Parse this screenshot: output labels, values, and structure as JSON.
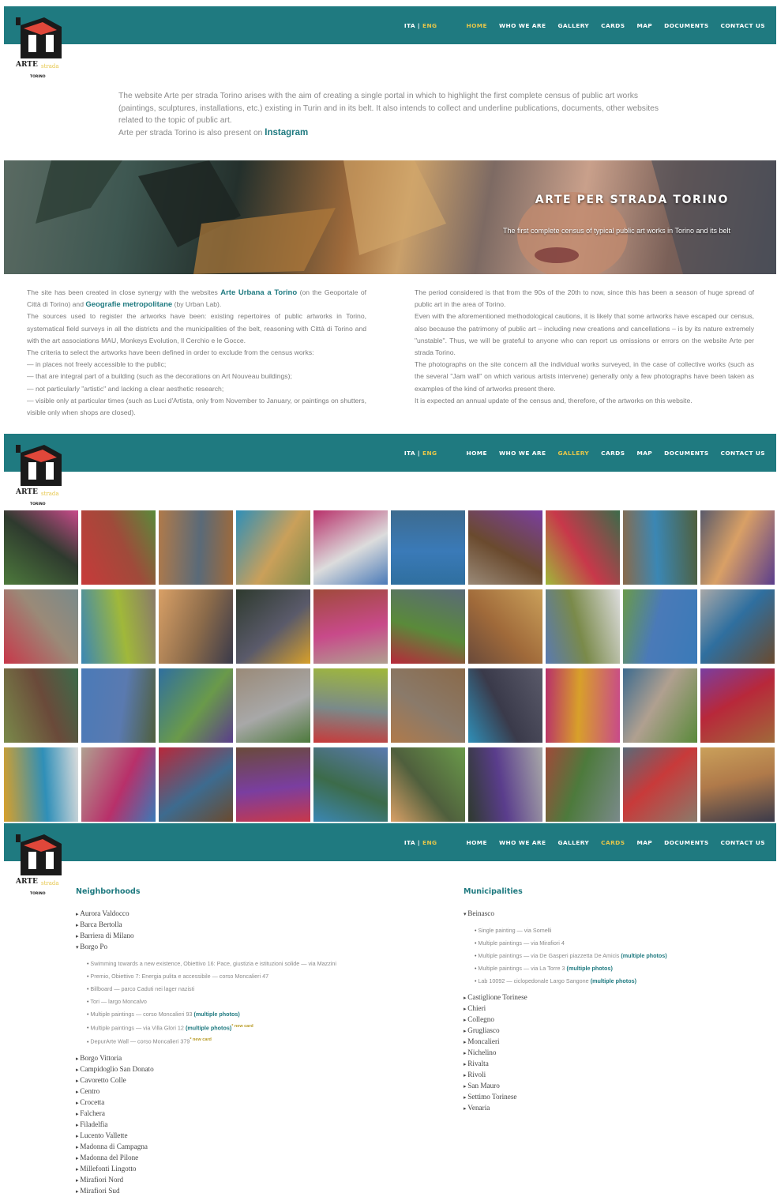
{
  "nav": {
    "lang_ita": "ITA",
    "lang_sep": " | ",
    "lang_eng": "ENG",
    "items": [
      "HOME",
      "WHO WE ARE",
      "GALLERY",
      "CARDS",
      "MAP",
      "DOCUMENTS",
      "CONTACT US"
    ]
  },
  "logo": {
    "text": "ARTE STRADA TORINO"
  },
  "intro": {
    "line1": "The website Arte per strada Torino arises with the aim of creating a single portal in which to highlight the first complete census of public art works (paintings, sculptures, installations, etc.) existing in Turin and in its belt. It also intends to collect and underline publications, documents, other websites related to the topic of public art.",
    "line2": "Arte per strada Torino is also present on",
    "instagram": "Instagram"
  },
  "hero": {
    "title": "ARTE PER STRADA TORINO",
    "subtitle": "The first complete census of typical public art works in Torino and its belt"
  },
  "about": {
    "left": {
      "p1_pre": "The site has been created in close synergy with the websites",
      "p1_link1": "Arte Urbana a Torino",
      "p1_mid": "(on the Geoportale of Città di Torino) and",
      "p1_link2": "Geografie metropolitane",
      "p1_post": "(by Urban Lab).",
      "p2": "The sources used to register the artworks have been: existing repertoires of public artworks in Torino, systematical field surveys in all the districts and the municipalities of the belt, reasoning with Città di Torino and with the art associations MAU, Monkeys Evolution, Il Cerchio e le Gocce.",
      "p3": "The criteria to select the artworks have been defined in order to exclude from the census works:",
      "b1": "— in places not freely accessible to the public;",
      "b2": "— that are integral part of a building (such as the decorations on Art Nouveau buildings);",
      "b3": "— not particularly \"artistic\" and lacking a clear aesthetic research;",
      "b4": "— visible only at particular times (such as Luci d'Artista, only from November to January, or paintings on shutters, visible only when shops are closed)."
    },
    "right": {
      "p1": "The period considered is that from the 90s of the 20th to now, since this has been a season of huge spread of public art in the area of Torino.",
      "p2": "Even with the aforementioned methodological cautions, it is likely that some artworks have escaped our census, also because the patrimony of public art – including new creations and cancellations – is by its nature extremely \"unstable\". Thus, we will be grateful to anyone who can report us omissions or errors on the website Arte per strada Torino.",
      "p3": "The photographs on the site concern all the individual works surveyed, in the case of collective works (such as the several \"Jam wall\" on which various artists intervene) generally only a few photographs have been taken as examples of the kind of artworks present there.",
      "p4": "It is expected an annual update of the census and, therefore, of the artworks on this website."
    }
  },
  "gallery": {
    "tile_colors": [
      [
        "#4d7a3c",
        "#c83a3a",
        "#b07a4a",
        "#2f8fb8",
        "#b8306a",
        "#3d6b8f",
        "#7a3ea0",
        "#3c6b4a",
        "#4f5f3d",
        "#5a3d8c"
      ],
      [
        "#c8384a",
        "#3b87b4",
        "#d9a066",
        "#2e3a2e",
        "#a04a3a",
        "#5a6a78",
        "#caa05a",
        "#dcdcdc",
        "#3a7ab8",
        "#6a4a2e"
      ],
      [
        "#7a8a4a",
        "#4a7ab8",
        "#2f6f9f",
        "#9a8a78",
        "#a0b83a",
        "#8a6a4a",
        "#5a5a6a",
        "#c84a8a",
        "#5a8a3a",
        "#a06a3a"
      ],
      [
        "#d8a02a",
        "#b0a090",
        "#b8283a",
        "#6a4a3a",
        "#5a7ab0",
        "#6a9a4a",
        "#a8a8a8",
        "#7a8a8a",
        "#8a7a6a",
        "#3a3a4a"
      ]
    ]
  },
  "cards": {
    "neighborhoods_heading": "Neighborhoods",
    "municipalities_heading": "Municipalities",
    "neighborhoods_before": [
      "Aurora Valdocco",
      "Barca Bertolla",
      "Barriera di Milano"
    ],
    "borgo_po": "Borgo Po",
    "borgo_po_items": [
      {
        "text": "Swimming towards a new existence, Obiettivo 16: Pace, giustizia e istituzioni solide — via Mazzini",
        "mp": "",
        "new": ""
      },
      {
        "text": "Premio, Obiettivo 7: Energia pulita e accessibile — corso Moncalieri 47",
        "mp": "",
        "new": ""
      },
      {
        "text": "Billboard — parco Caduti nei lager nazisti",
        "mp": "",
        "new": ""
      },
      {
        "text": "Tori — largo Moncalvo",
        "mp": "",
        "new": ""
      },
      {
        "text": "Multiple paintings — corso Moncalieri 93",
        "mp": "(multiple photos)",
        "new": ""
      },
      {
        "text": "Multiple paintings — via Villa Glori 12",
        "mp": "(multiple photos)",
        "new": "* new card"
      },
      {
        "text": "DepurArte Wall — corso Moncalieri 379",
        "mp": "",
        "new": "* new card"
      }
    ],
    "neighborhoods_after": [
      "Borgo Vittoria",
      "Campidoglio San Donato",
      "Cavoretto Colle",
      "Centro",
      "Crocetta",
      "Falchera",
      "Filadelfia",
      "Lucento Vallette",
      "Madonna di Campagna",
      "Madonna del Pilone",
      "Millefonti Lingotto",
      "Mirafiori Nord",
      "Mirafiori Sud"
    ],
    "beinasco": "Beinasco",
    "beinasco_items": [
      {
        "text": "Single painting — via Somelli",
        "mp": ""
      },
      {
        "text": "Multiple paintings — via Mirafiori 4",
        "mp": ""
      },
      {
        "text": "Multiple paintings — via De Gasperi piazzetta De Amicis",
        "mp": "(multiple photos)"
      },
      {
        "text": "Multiple paintings — via La Torre 3",
        "mp": "(multiple photos)"
      },
      {
        "text": "Lab 10092 — ciclopedonale Largo Sangone",
        "mp": "(multiple photos)"
      }
    ],
    "municipalities_after": [
      "Castiglione Torinese",
      "Chieri",
      "Collegno",
      "Grugliasco",
      "Moncalieri",
      "Nichelino",
      "Rivalta",
      "Rivoli",
      "San Mauro",
      "Settimo Torinese",
      "Venaria"
    ]
  }
}
